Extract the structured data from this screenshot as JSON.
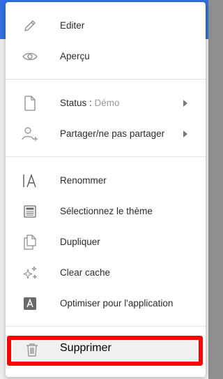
{
  "colors": {
    "app_header": "#2f6fe0",
    "highlight_border": "#ff0000",
    "icon_stroke": "#8a8a8a"
  },
  "menu": {
    "group1": [
      {
        "label": "Editer",
        "icon": "pencil-icon"
      },
      {
        "label": "Aperçu",
        "icon": "eye-icon"
      }
    ],
    "status": {
      "prefix": "Status : ",
      "value": "Démo",
      "icon": "file-icon",
      "has_submenu": true
    },
    "share": {
      "label": "Partager/ne pas partager",
      "icon": "user-add-icon",
      "has_submenu": true
    },
    "group3": [
      {
        "label": "Renommer",
        "icon": "rename-text-icon"
      },
      {
        "label": "Sélectionnez le thème",
        "icon": "theme-layout-icon"
      },
      {
        "label": "Dupliquer",
        "icon": "duplicate-icon"
      },
      {
        "label": "Clear cache",
        "icon": "sparkles-icon"
      },
      {
        "label": "Optimiser pour l'application",
        "icon": "app-letter-icon"
      }
    ],
    "delete": {
      "label": "Supprimer",
      "icon": "trash-icon"
    }
  }
}
